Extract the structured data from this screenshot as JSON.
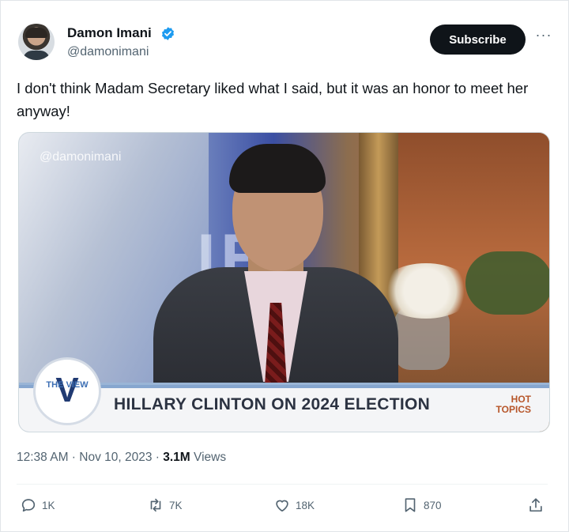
{
  "author": {
    "display_name": "Damon Imani",
    "handle": "@damonimani",
    "verified": true
  },
  "header": {
    "subscribe_label": "Subscribe",
    "more_label": "···"
  },
  "tweet": {
    "text": "I don't think Madam Secretary liked what I said, but it was an honor to meet her anyway!"
  },
  "media": {
    "watermark": "@damonimani",
    "backdrop_letters": "IE",
    "logo_text": "THE VIEW",
    "logo_letter": "V",
    "headline": "HILLARY CLINTON ON 2024 ELECTION",
    "segment_badge_line1": "HOT",
    "segment_badge_line2": "TOPICS"
  },
  "meta": {
    "timestamp": "12:38 AM · Nov 10, 2023 · ",
    "views_count": "3.1M",
    "views_label": "Views"
  },
  "actions": {
    "replies": "1K",
    "reposts": "7K",
    "likes": "18K",
    "bookmarks": "870"
  },
  "colors": {
    "text_primary": "#0f1419",
    "text_secondary": "#536471",
    "verified_blue": "#1d9bf0",
    "subscribe_bg": "#0f1419"
  },
  "icons": [
    "verified-badge-icon",
    "more-icon",
    "reply-icon",
    "repost-icon",
    "like-icon",
    "bookmark-icon",
    "share-icon"
  ]
}
